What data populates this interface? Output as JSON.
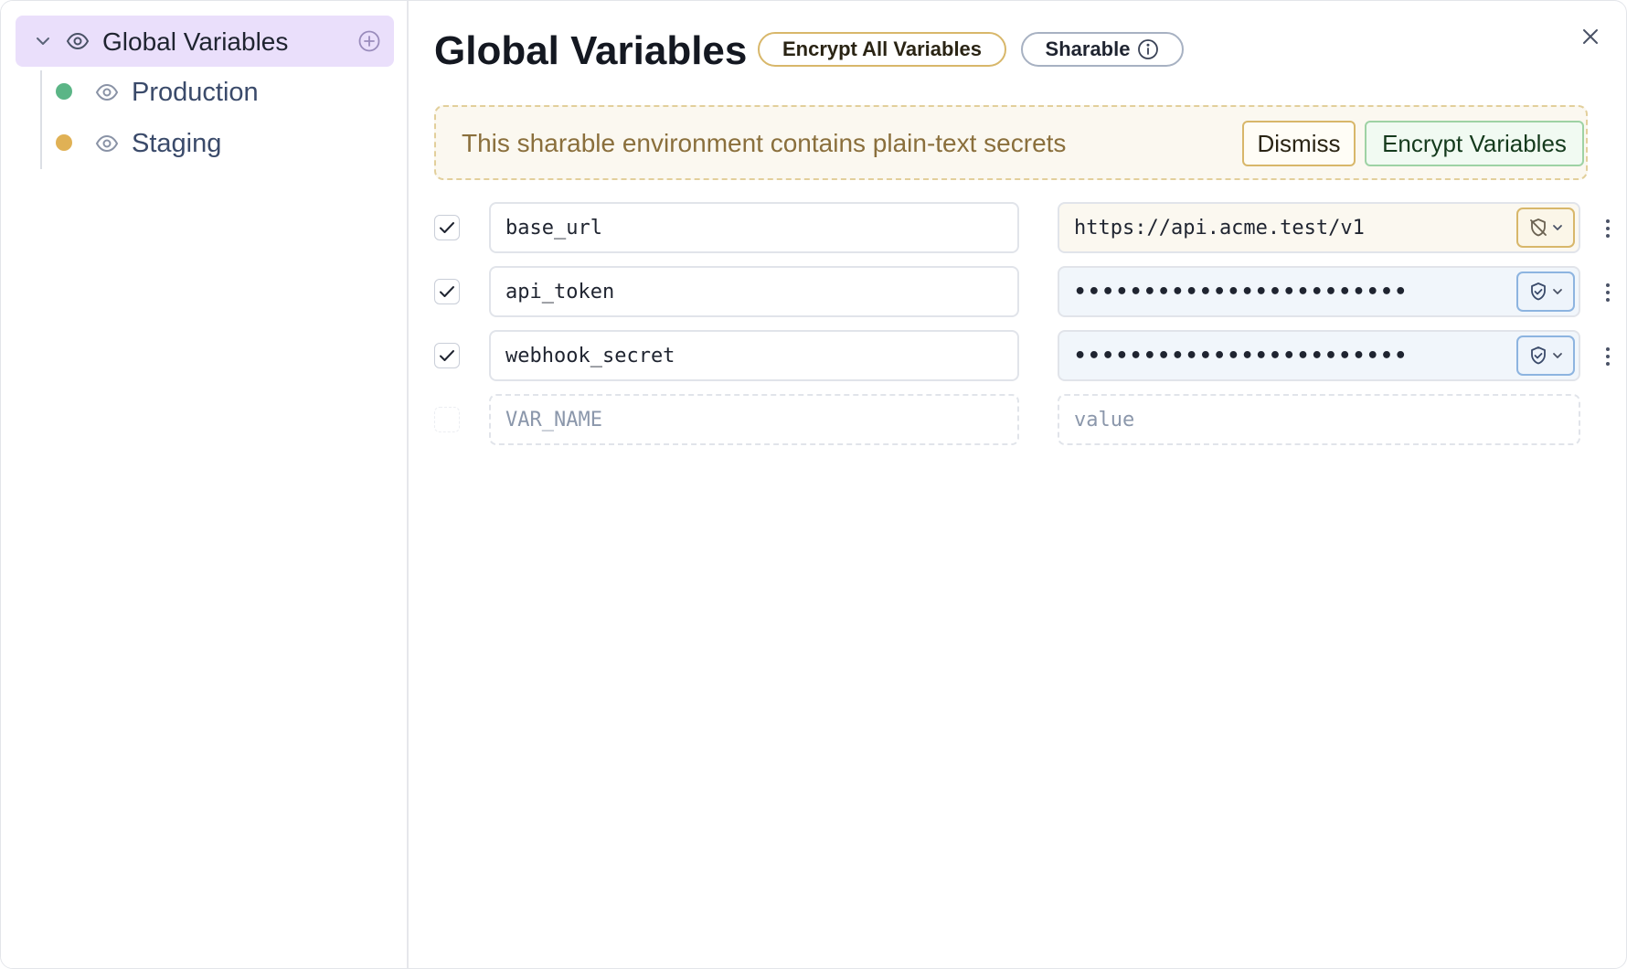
{
  "sidebar": {
    "root": {
      "label": "Global Variables"
    },
    "environments": [
      {
        "label": "Production",
        "color": "#5bb586"
      },
      {
        "label": "Staging",
        "color": "#e0b155"
      }
    ]
  },
  "header": {
    "title": "Global Variables",
    "encrypt_all_label": "Encrypt All Variables",
    "sharable_label": "Sharable"
  },
  "banner": {
    "message": "This sharable environment contains plain-text secrets",
    "dismiss_label": "Dismiss",
    "encrypt_label": "Encrypt Variables"
  },
  "variables": [
    {
      "name": "base_url",
      "value": "https://api.acme.test/v1",
      "enabled": true,
      "encrypted": false
    },
    {
      "name": "api_token",
      "value": "••••••••••••••••••••••••",
      "enabled": true,
      "encrypted": true
    },
    {
      "name": "webhook_secret",
      "value": "••••••••••••••••••••••••",
      "enabled": true,
      "encrypted": true
    }
  ],
  "new_variable": {
    "name_placeholder": "VAR_NAME",
    "value_placeholder": "value"
  },
  "icons": {
    "chevron": "chevron-down-icon",
    "eye": "eye-icon",
    "add": "plus-circle-icon",
    "info": "info-icon",
    "close": "close-icon",
    "shield": "shield-check-icon",
    "shield_off": "shield-off-icon",
    "more": "kebab-icon"
  }
}
